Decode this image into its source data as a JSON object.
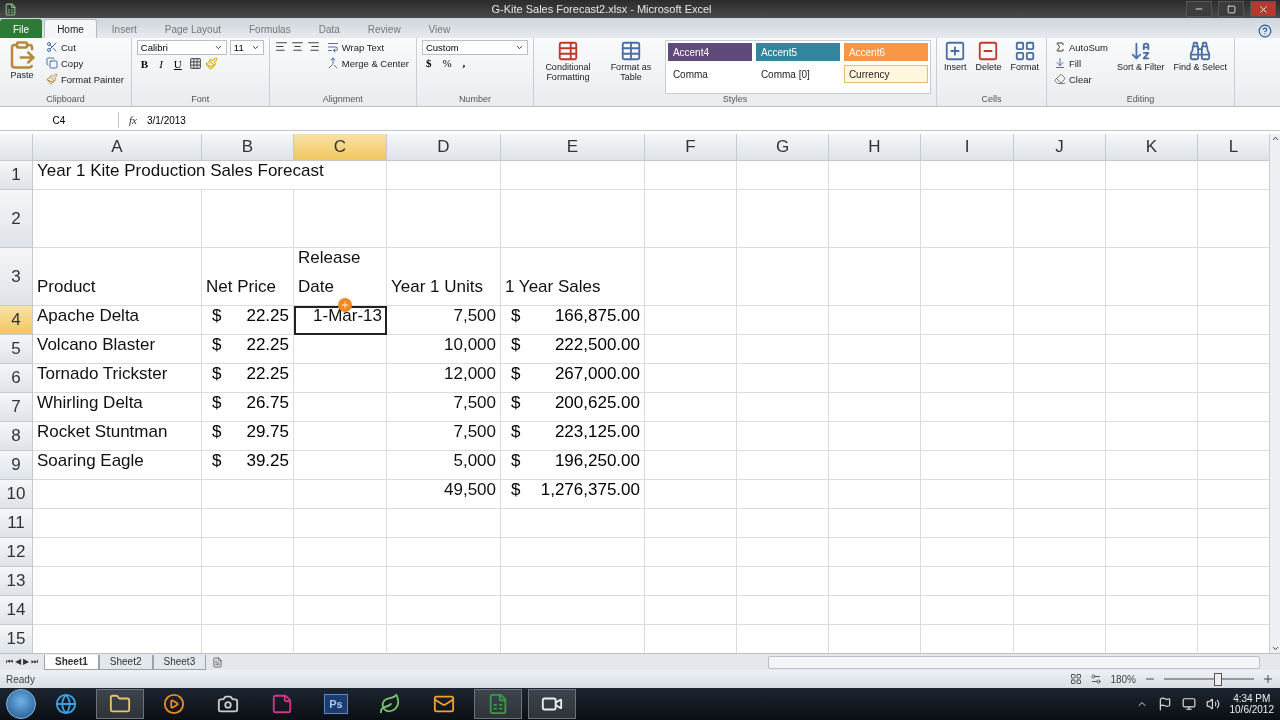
{
  "window": {
    "title": "G-Kite Sales Forecast2.xlsx - Microsoft Excel"
  },
  "ribbon_tabs": [
    {
      "label": "File",
      "kind": "file",
      "selected": false
    },
    {
      "label": "Home",
      "kind": "tab",
      "selected": true
    },
    {
      "label": "Insert",
      "kind": "tab",
      "selected": false
    },
    {
      "label": "Page Layout",
      "kind": "tab",
      "selected": false
    },
    {
      "label": "Formulas",
      "kind": "tab",
      "selected": false
    },
    {
      "label": "Data",
      "kind": "tab",
      "selected": false
    },
    {
      "label": "Review",
      "kind": "tab",
      "selected": false
    },
    {
      "label": "View",
      "kind": "tab",
      "selected": false
    }
  ],
  "ribbon": {
    "clipboard": {
      "label": "Clipboard",
      "paste": "Paste",
      "cut": "Cut",
      "copy": "Copy",
      "format_painter": "Format Painter"
    },
    "font": {
      "label": "Font",
      "name": "Calibri",
      "size": "11",
      "bold": "B",
      "italic": "I",
      "underline": "U"
    },
    "alignment": {
      "label": "Alignment",
      "wrap_text": "Wrap Text",
      "merge_center": "Merge & Center"
    },
    "number": {
      "label": "Number",
      "format": "Custom",
      "currency": "$",
      "percent": "%",
      "comma": ","
    },
    "styles": {
      "label": "Styles",
      "conditional": "Conditional Formatting",
      "format_table": "Format as Table",
      "cells": [
        {
          "label": "Accent4",
          "color": "#604a7b",
          "selected": false
        },
        {
          "label": "Accent5",
          "color": "#31859c",
          "selected": false
        },
        {
          "label": "Accent6",
          "color": "#f79646",
          "selected": false
        },
        {
          "label": "Comma",
          "selected": false
        },
        {
          "label": "Comma [0]",
          "selected": false
        },
        {
          "label": "Currency",
          "selected": true
        }
      ]
    },
    "cells": {
      "label": "Cells",
      "insert": "Insert",
      "delete": "Delete",
      "format": "Format"
    },
    "editing": {
      "label": "Editing",
      "autosum": "AutoSum",
      "fill": "Fill",
      "clear": "Clear",
      "sort_filter": "Sort & Filter",
      "find_select": "Find & Select"
    }
  },
  "formula_bar": {
    "name_box": "C4",
    "fx": "fx",
    "formula": "3/1/2013"
  },
  "columns": [
    {
      "label": "A",
      "selected": false
    },
    {
      "label": "B",
      "selected": false
    },
    {
      "label": "C",
      "selected": true
    },
    {
      "label": "D",
      "selected": false
    },
    {
      "label": "E",
      "selected": false
    },
    {
      "label": "F",
      "selected": false
    },
    {
      "label": "G",
      "selected": false
    },
    {
      "label": "H",
      "selected": false
    },
    {
      "label": "I",
      "selected": false
    },
    {
      "label": "J",
      "selected": false
    },
    {
      "label": "K",
      "selected": false
    },
    {
      "label": "L",
      "selected": false
    }
  ],
  "rows": [
    {
      "number": "1",
      "selected": false,
      "cells": [
        {
          "kind": "title",
          "text": "Year 1 Kite Production Sales Forecast",
          "selected": false
        }
      ]
    },
    {
      "number": "2",
      "selected": false,
      "cells": []
    },
    {
      "number": "3",
      "selected": false,
      "cells": [
        {
          "kind": "text",
          "text": "Product",
          "selected": false
        },
        {
          "kind": "text",
          "text": "Net Price",
          "selected": false
        },
        {
          "kind": "wrap",
          "text": "Release Date",
          "selected": false
        },
        {
          "kind": "text",
          "text": "Year 1 Units",
          "selected": false
        },
        {
          "kind": "text",
          "text": "1 Year Sales",
          "selected": false
        }
      ]
    },
    {
      "number": "4",
      "selected": true,
      "cells": [
        {
          "kind": "text",
          "text": "Apache Delta",
          "selected": false
        },
        {
          "kind": "money",
          "symbol": "$",
          "amount": "22.25",
          "selected": false
        },
        {
          "kind": "number",
          "text": "1-Mar-13",
          "selected": true
        },
        {
          "kind": "number",
          "text": "7,500",
          "selected": false
        },
        {
          "kind": "money",
          "symbol": "$",
          "amount": "166,875.00",
          "selected": false
        }
      ]
    },
    {
      "number": "5",
      "selected": false,
      "cells": [
        {
          "kind": "text",
          "text": "Volcano Blaster",
          "selected": false
        },
        {
          "kind": "money",
          "symbol": "$",
          "amount": "22.25",
          "selected": false
        },
        {
          "kind": "blank",
          "selected": false
        },
        {
          "kind": "number",
          "text": "10,000",
          "selected": false
        },
        {
          "kind": "money",
          "symbol": "$",
          "amount": "222,500.00",
          "selected": false
        }
      ]
    },
    {
      "number": "6",
      "selected": false,
      "cells": [
        {
          "kind": "text",
          "text": "Tornado Trickster",
          "selected": false
        },
        {
          "kind": "money",
          "symbol": "$",
          "amount": "22.25",
          "selected": false
        },
        {
          "kind": "blank",
          "selected": false
        },
        {
          "kind": "number",
          "text": "12,000",
          "selected": false
        },
        {
          "kind": "money",
          "symbol": "$",
          "amount": "267,000.00",
          "selected": false
        }
      ]
    },
    {
      "number": "7",
      "selected": false,
      "cells": [
        {
          "kind": "text",
          "text": "Whirling Delta",
          "selected": false
        },
        {
          "kind": "money",
          "symbol": "$",
          "amount": "26.75",
          "selected": false
        },
        {
          "kind": "blank",
          "selected": false
        },
        {
          "kind": "number",
          "text": "7,500",
          "selected": false
        },
        {
          "kind": "money",
          "symbol": "$",
          "amount": "200,625.00",
          "selected": false
        }
      ]
    },
    {
      "number": "8",
      "selected": false,
      "cells": [
        {
          "kind": "text",
          "text": "Rocket Stuntman",
          "selected": false
        },
        {
          "kind": "money",
          "symbol": "$",
          "amount": "29.75",
          "selected": false
        },
        {
          "kind": "blank",
          "selected": false
        },
        {
          "kind": "number",
          "text": "7,500",
          "selected": false
        },
        {
          "kind": "money",
          "symbol": "$",
          "amount": "223,125.00",
          "selected": false
        }
      ]
    },
    {
      "number": "9",
      "selected": false,
      "cells": [
        {
          "kind": "text",
          "text": "Soaring Eagle",
          "selected": false
        },
        {
          "kind": "money",
          "symbol": "$",
          "amount": "39.25",
          "selected": false
        },
        {
          "kind": "blank",
          "selected": false
        },
        {
          "kind": "number",
          "text": "5,000",
          "selected": false
        },
        {
          "kind": "money",
          "symbol": "$",
          "amount": "196,250.00",
          "selected": false
        }
      ]
    },
    {
      "number": "10",
      "selected": false,
      "cells": [
        {
          "kind": "blank",
          "selected": false
        },
        {
          "kind": "blank",
          "selected": false
        },
        {
          "kind": "blank",
          "selected": false
        },
        {
          "kind": "number",
          "text": "49,500",
          "selected": false
        },
        {
          "kind": "money",
          "symbol": "$",
          "amount": "1,276,375.00",
          "selected": false
        }
      ]
    },
    {
      "number": "11",
      "selected": false,
      "cells": []
    },
    {
      "number": "12",
      "selected": false,
      "cells": []
    },
    {
      "number": "13",
      "selected": false,
      "cells": []
    },
    {
      "number": "14",
      "selected": false,
      "cells": []
    },
    {
      "number": "15",
      "selected": false,
      "cells": []
    }
  ],
  "sheet_nav": [
    "⏮",
    "◀",
    "▶",
    "⏭"
  ],
  "sheet_tabs": [
    {
      "label": "Sheet1",
      "selected": true
    },
    {
      "label": "Sheet2",
      "selected": false
    },
    {
      "label": "Sheet3",
      "selected": false
    }
  ],
  "status_bar": {
    "status": "Ready",
    "zoom": "180%",
    "zoom_level": {
      "level": 0.6
    }
  },
  "taskbar": {
    "apps": [
      {
        "kind": "ie",
        "selected": false
      },
      {
        "kind": "folder",
        "selected": true
      },
      {
        "kind": "media",
        "selected": false
      },
      {
        "kind": "camera",
        "selected": false
      },
      {
        "kind": "note",
        "selected": false
      },
      {
        "kind": "ps",
        "label": "Ps",
        "selected": false
      },
      {
        "kind": "leaf",
        "selected": false
      },
      {
        "kind": "mail",
        "selected": false
      },
      {
        "kind": "excel",
        "selected": true
      },
      {
        "kind": "video",
        "selected": true
      }
    ],
    "time": "4:34 PM",
    "date": "10/6/2012"
  }
}
